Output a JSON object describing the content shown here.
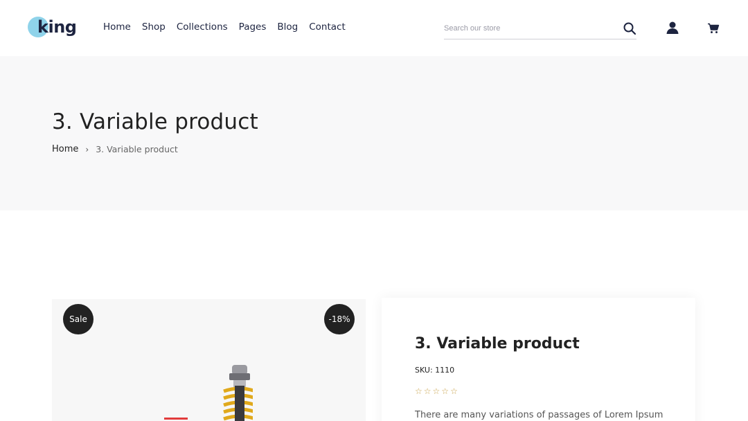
{
  "header": {
    "logo_text": "king",
    "nav": [
      "Home",
      "Shop",
      "Collections",
      "Pages",
      "Blog",
      "Contact"
    ],
    "search_placeholder": "Search our store",
    "icons": {
      "search": "search-icon",
      "account": "user-icon",
      "cart": "cart-icon"
    }
  },
  "hero": {
    "title": "3. Variable product",
    "breadcrumb": {
      "home": "Home",
      "separator": "›",
      "current": "3. Variable product"
    }
  },
  "product": {
    "badges": {
      "sale": "Sale",
      "discount": "-18%"
    },
    "title": "3. Variable product",
    "sku": "SKU: 1110",
    "rating": {
      "value": 0,
      "max": 5
    },
    "description": "There are many variations of passages of Lorem Ipsum"
  },
  "colors": {
    "accent_logo": "#8fd3ea",
    "dark": "#222222",
    "hero_bg": "#f8f8f9",
    "star": "#c8a24a"
  }
}
